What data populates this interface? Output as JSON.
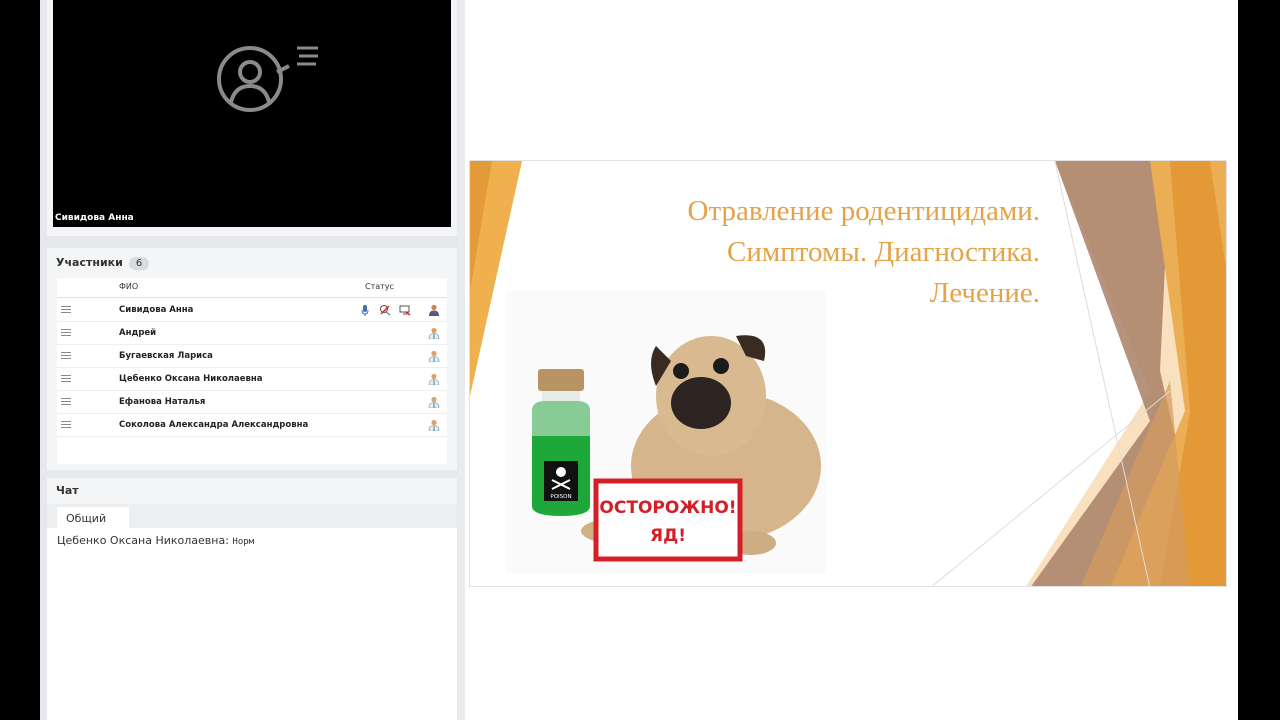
{
  "video": {
    "speaker_name": "Сивидова Анна"
  },
  "participants": {
    "title": "Участники",
    "count": "6",
    "col_name": "ФИО",
    "col_status": "Статус",
    "rows": [
      {
        "name": "Сивидова Анна"
      },
      {
        "name": "Андрей"
      },
      {
        "name": "Бугаевская Лариса"
      },
      {
        "name": "Цебенко Оксана Николаевна"
      },
      {
        "name": "Ефанова Наталья"
      },
      {
        "name": "Соколова Александра Александровна"
      }
    ]
  },
  "chat": {
    "title": "Чат",
    "tab_general": "Общий",
    "messages": [
      {
        "author": "Цебенко Оксана Николаевна:",
        "text": "Норм"
      }
    ]
  },
  "slide": {
    "title_line1": "Отравление родентицидами.",
    "title_line2": "Симптомы. Диагностика.",
    "title_line3": "Лечение.",
    "bottle_label": "POISON",
    "sign_line1": "ОСТОРОЖНО!",
    "sign_line2": "ЯД!"
  },
  "colors": {
    "accent_orange": "#e4a348",
    "brown": "#a07560",
    "poison_green": "#1fa83a",
    "sign_red": "#d41f26"
  }
}
